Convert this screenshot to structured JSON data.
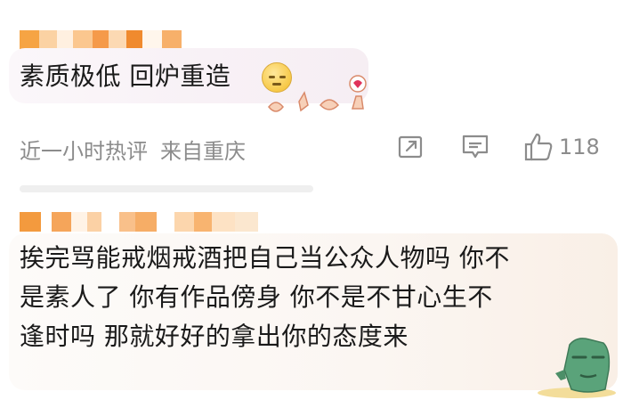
{
  "comments": [
    {
      "text": "素质极低 回炉重造",
      "meta": {
        "time": "近一小时热评",
        "location": "来自重庆"
      },
      "likes": "118"
    },
    {
      "lines": [
        "挨完骂能戒烟戒酒把自己当公众人物吗  你不",
        "是素人了   你有作品傍身  你不是不甘心生不",
        "逢时吗  那就好好的拿出你的态度来"
      ]
    }
  ],
  "colors": {
    "meta": "#8c8c8c",
    "text": "#1a1a1a",
    "mosaic_orange": "#f5a623"
  }
}
